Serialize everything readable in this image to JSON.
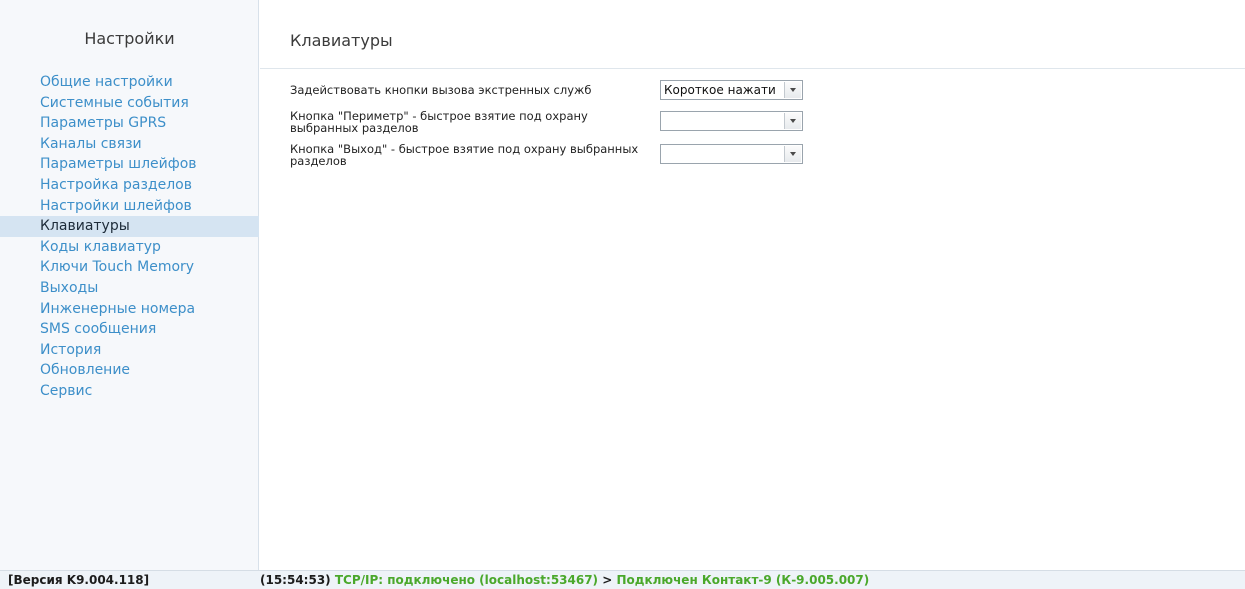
{
  "sidebar": {
    "title": "Настройки",
    "items": [
      {
        "label": "Общие настройки",
        "active": false
      },
      {
        "label": "Системные события",
        "active": false
      },
      {
        "label": "Параметры GPRS",
        "active": false
      },
      {
        "label": "Каналы связи",
        "active": false
      },
      {
        "label": "Параметры шлейфов",
        "active": false
      },
      {
        "label": "Настройка разделов",
        "active": false
      },
      {
        "label": "Настройки шлейфов",
        "active": false
      },
      {
        "label": "Клавиатуры",
        "active": true
      },
      {
        "label": "Коды клавиатур",
        "active": false
      },
      {
        "label": "Ключи Touch Memory",
        "active": false
      },
      {
        "label": "Выходы",
        "active": false
      },
      {
        "label": "Инженерные номера",
        "active": false
      },
      {
        "label": "SMS сообщения",
        "active": false
      },
      {
        "label": "История",
        "active": false
      },
      {
        "label": "Обновление",
        "active": false
      },
      {
        "label": "Сервис",
        "active": false
      }
    ]
  },
  "main": {
    "title": "Клавиатуры",
    "settings": [
      {
        "label": "Задействовать кнопки вызова экстренных служб",
        "value": "Короткое нажати"
      },
      {
        "label": "Кнопка \"Периметр\" - быстрое взятие под охрану выбранных разделов",
        "value": ""
      },
      {
        "label": "Кнопка \"Выход\" - быстрое взятие под охрану выбранных разделов",
        "value": ""
      }
    ]
  },
  "status_bar": {
    "version": "[Версия K9.004.118]",
    "time": "(15:54:53)",
    "connection": "TCP/IP: подключено (localhost:53467)",
    "arrow": ">",
    "device": "Подключен Контакт-9 (К-9.005.007)"
  },
  "colors": {
    "nav_link": "#3d8fc9",
    "nav_active_bg": "#d5e4f2",
    "status_green": "#4aa82b"
  },
  "icons": {
    "dropdown": "chevron-down-icon"
  }
}
